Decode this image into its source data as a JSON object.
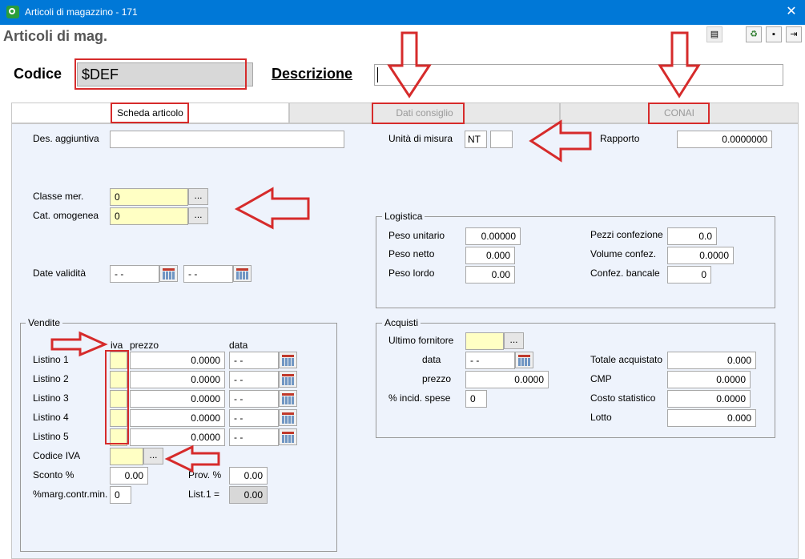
{
  "window": {
    "title": "Articoli di magazzino - 171"
  },
  "header": {
    "title": "Articoli di mag."
  },
  "top": {
    "codice_label": "Codice",
    "codice_value": "$DEF",
    "descrizione_label": "Descrizione",
    "descrizione_value": ""
  },
  "tabs": [
    {
      "label": "Scheda articolo",
      "active": true
    },
    {
      "label": "Dati consiglio",
      "active": false
    },
    {
      "label": "CONAI",
      "active": false
    }
  ],
  "general": {
    "des_aggiuntiva_label": "Des. aggiuntiva",
    "des_aggiuntiva_value": "",
    "unita_label": "Unità di misura",
    "unita_value1": "NT",
    "unita_value2": "",
    "rapporto_label": "Rapporto",
    "rapporto_value": "0.0000000",
    "classe_label": "Classe mer.",
    "classe_value": "0",
    "cat_label": "Cat. omogenea",
    "cat_value": "0",
    "date_label": "Date validità",
    "date_from": "- -",
    "date_to": "- -",
    "browse": "..."
  },
  "logistica": {
    "title": "Logistica",
    "peso_unitario_label": "Peso unitario",
    "peso_unitario": "0.00000",
    "peso_netto_label": "Peso netto",
    "peso_netto": "0.000",
    "peso_lordo_label": "Peso lordo",
    "peso_lordo": "0.00",
    "pezzi_label": "Pezzi confezione",
    "pezzi": "0.0",
    "volume_label": "Volume confez.",
    "volume": "0.0000",
    "bancale_label": "Confez. bancale",
    "bancale": "0"
  },
  "vendite": {
    "title": "Vendite",
    "col_iva": "iva",
    "col_prezzo": "prezzo",
    "col_data": "data",
    "rows": [
      {
        "label": "Listino 1",
        "iva": "",
        "prezzo": "0.0000",
        "data": "- -"
      },
      {
        "label": "Listino 2",
        "iva": "",
        "prezzo": "0.0000",
        "data": "- -"
      },
      {
        "label": "Listino 3",
        "iva": "",
        "prezzo": "0.0000",
        "data": "- -"
      },
      {
        "label": "Listino 4",
        "iva": "",
        "prezzo": "0.0000",
        "data": "- -"
      },
      {
        "label": "Listino 5",
        "iva": "",
        "prezzo": "0.0000",
        "data": "- -"
      }
    ],
    "codice_iva_label": "Codice IVA",
    "codice_iva": "",
    "sconto_label": "Sconto %",
    "sconto": "0.00",
    "prov_label": "Prov. %",
    "prov": "0.00",
    "marg_label": "%marg.contr.min.",
    "marg": "0",
    "list1_label": "List.1 =",
    "list1": "0.00"
  },
  "acquisti": {
    "title": "Acquisti",
    "fornitore_label": "Ultimo  fornitore",
    "fornitore": "",
    "data_label": "data",
    "data": "- -",
    "prezzo_label": "prezzo",
    "prezzo": "0.0000",
    "incid_label": "% incid. spese",
    "incid": "0",
    "totale_label": "Totale acquistato",
    "totale": "0.000",
    "cmp_label": "CMP",
    "cmp": "0.0000",
    "costo_label": "Costo statistico",
    "costo": "0.0000",
    "lotto_label": "Lotto",
    "lotto": "0.000"
  },
  "colors": {
    "titlebar": "#0078d7",
    "panel": "#eef3fc",
    "highlight": "#ffffc4",
    "annotation": "#d62b2b"
  }
}
